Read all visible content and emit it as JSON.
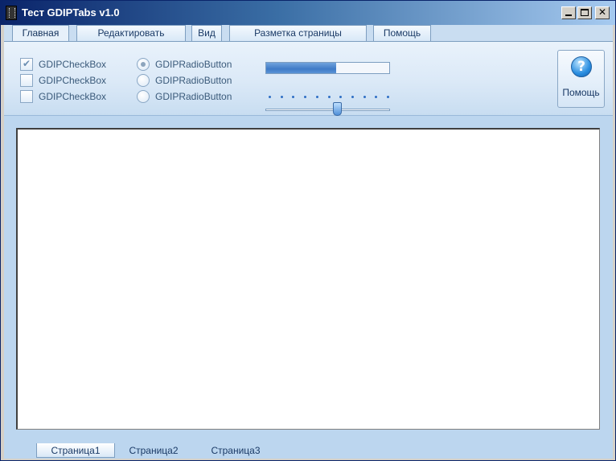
{
  "window": {
    "title": "Тест GDIPTabs v1.0"
  },
  "tabs": [
    {
      "label": "Главная",
      "active": true
    },
    {
      "label": "Редактировать"
    },
    {
      "label": "Вид"
    },
    {
      "label": "Разметка страницы"
    },
    {
      "label": "Помощь"
    }
  ],
  "ribbon": {
    "checkboxes": [
      {
        "label": "GDIPCheckBox",
        "checked": true
      },
      {
        "label": "GDIPCheckBox",
        "checked": false
      },
      {
        "label": "GDIPCheckBox",
        "checked": false
      }
    ],
    "radios": [
      {
        "label": "GDIPRadioButton",
        "selected": true
      },
      {
        "label": "GDIPRadioButton",
        "selected": false
      },
      {
        "label": "GDIPRadioButton",
        "selected": false
      }
    ],
    "progress_fraction": 0.57,
    "slider": {
      "ticks": 11,
      "value_fraction": 0.58
    },
    "help_button_label": "Помощь",
    "help_icon": "question-icon"
  },
  "bottom_tabs": [
    {
      "label": "Страница1",
      "active": true
    },
    {
      "label": "Страница2"
    },
    {
      "label": "Страница3"
    }
  ]
}
